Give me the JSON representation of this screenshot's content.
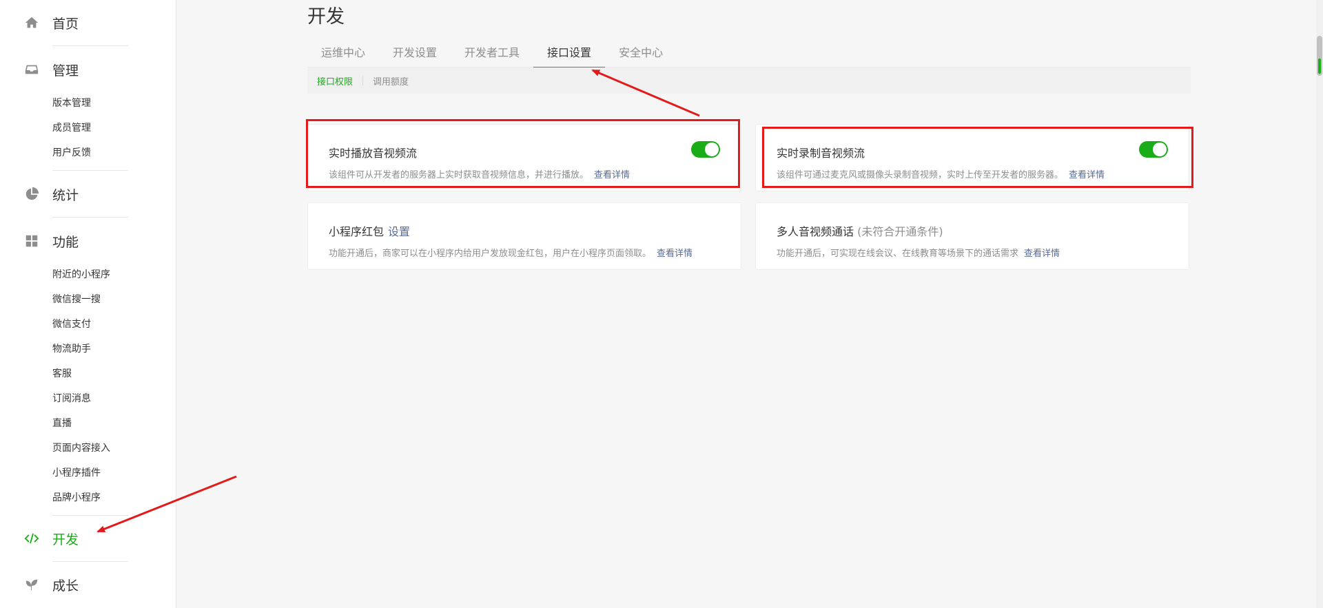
{
  "sidebar": {
    "home": "首页",
    "manage": "管理",
    "manage_items": [
      "版本管理",
      "成员管理",
      "用户反馈"
    ],
    "stats": "统计",
    "features": "功能",
    "feature_items": [
      "附近的小程序",
      "微信搜一搜",
      "微信支付",
      "物流助手",
      "客服",
      "订阅消息",
      "直播",
      "页面内容接入",
      "小程序插件",
      "品牌小程序"
    ],
    "develop": "开发",
    "growth": "成长"
  },
  "page": {
    "title": "开发",
    "tabs": [
      "运维中心",
      "开发设置",
      "开发者工具",
      "接口设置",
      "安全中心"
    ],
    "subtabs": [
      "接口权限",
      "调用额度"
    ]
  },
  "cards": {
    "live_play": {
      "title": "实时播放音视频流",
      "desc": "该组件可从开发者的服务器上实时获取音视频信息，并进行播放。",
      "link": "查看详情"
    },
    "live_push": {
      "title": "实时录制音视频流",
      "desc": "该组件可通过麦克风或摄像头录制音视频，实时上传至开发者的服务器。",
      "link": "查看详情"
    },
    "red_packet": {
      "title": "小程序红包",
      "action": "设置",
      "desc": "功能开通后，商家可以在小程序内给用户发放现金红包，用户在小程序页面领取。",
      "link": "查看详情"
    },
    "voip": {
      "title": "多人音视频通话",
      "note": "(未符合开通条件)",
      "desc": "功能开通后，可实现在线会议、在线教育等场景下的通话需求",
      "link": "查看详情"
    }
  },
  "colors": {
    "accent": "#1aad19",
    "link": "#576b95",
    "highlight": "#e41a1a"
  }
}
